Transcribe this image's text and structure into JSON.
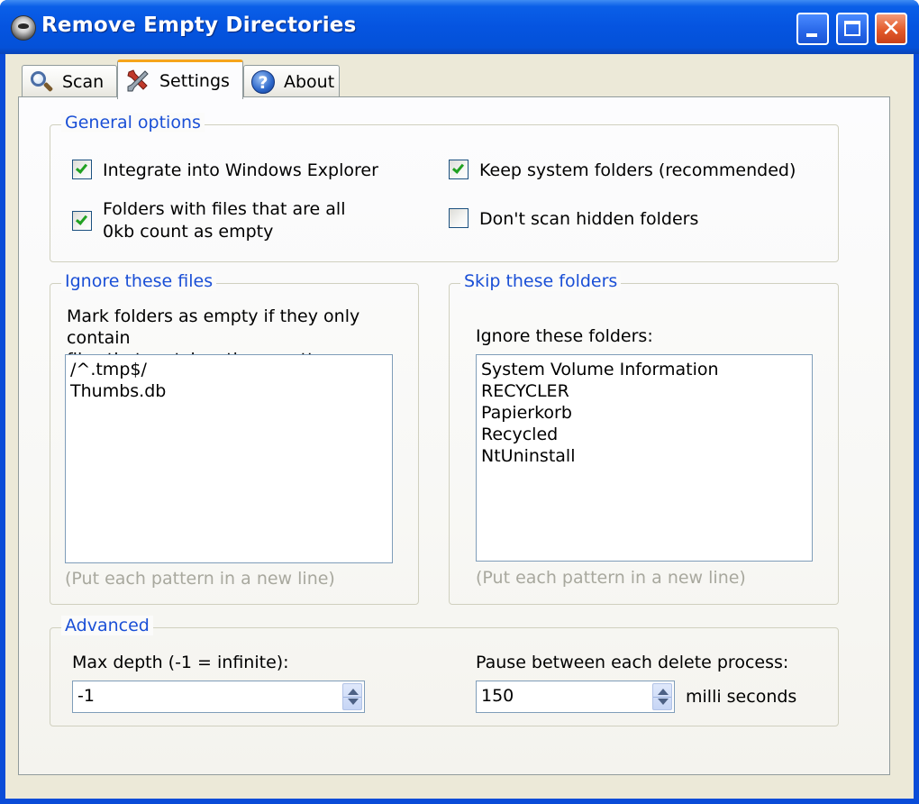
{
  "window": {
    "title": "Remove Empty Directories"
  },
  "window_buttons": {
    "close_glyph": "✕"
  },
  "tabs": [
    {
      "label": "Scan",
      "icon": "search-icon"
    },
    {
      "label": "Settings",
      "icon": "tools-icon",
      "active": true
    },
    {
      "label": "About",
      "icon": "help-icon",
      "glyph": "?"
    }
  ],
  "general": {
    "legend": "General options",
    "integrate": {
      "label": "Integrate into Windows Explorer",
      "checked": true
    },
    "zero_kb": {
      "label_line1": "Folders with files that are all",
      "label_line2": "0kb count as empty",
      "checked": true
    },
    "keep_system": {
      "label": "Keep system folders (recommended)",
      "checked": true
    },
    "skip_hidden": {
      "label": "Don't scan hidden folders",
      "checked": false
    }
  },
  "ignore_files": {
    "legend": "Ignore these files",
    "description_line1": "Mark folders as empty if they only contain",
    "description_line2": "files that matches these patterns:",
    "patterns": [
      "/^.tmp$/",
      "Thumbs.db"
    ],
    "hint": "(Put each pattern in a new line)"
  },
  "skip_folders": {
    "legend": "Skip these folders",
    "label": "Ignore these folders:",
    "patterns": [
      "System Volume Information",
      "RECYCLER",
      "Papierkorb",
      "Recycled",
      "NtUninstall"
    ],
    "hint": "(Put each pattern in a new line)"
  },
  "advanced": {
    "legend": "Advanced",
    "max_depth_label": "Max depth (-1 = infinite):",
    "max_depth_value": "-1",
    "pause_label": "Pause between each delete process:",
    "pause_value": "150",
    "pause_unit": "milli seconds"
  },
  "colors": {
    "titlebar": "#0554e0",
    "legend_text": "#1a4fd6",
    "checkmark": "#21a121",
    "active_tab_accent": "#f5a41b",
    "close_button": "#e35a2a"
  }
}
